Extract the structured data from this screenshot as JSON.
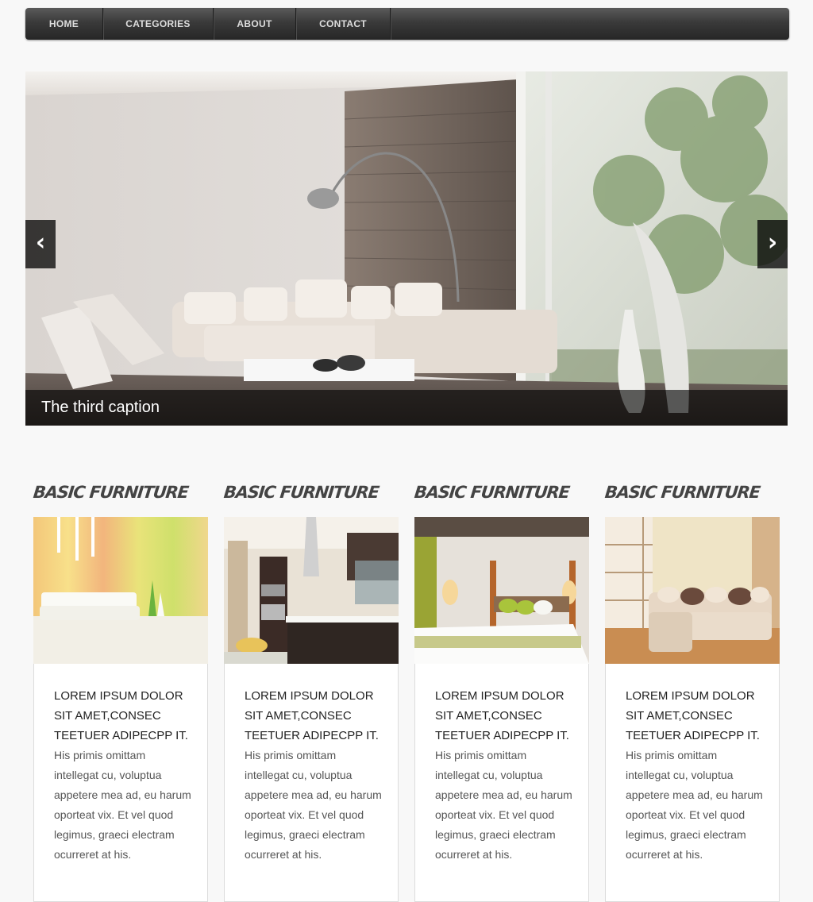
{
  "nav": {
    "items": [
      {
        "label": "HOME"
      },
      {
        "label": "CATEGORIES"
      },
      {
        "label": "ABOUT"
      },
      {
        "label": "CONTACT"
      }
    ]
  },
  "slider": {
    "caption": "The third caption",
    "prev_icon": "‹",
    "next_icon": "›"
  },
  "cards": [
    {
      "heading": "BASIC FURNITURE",
      "title": "LOREM IPSUM DOLOR SIT AMET,CONSEC TEETUER ADIPECPP IT.",
      "text": "His primis omittam intellegat cu, voluptua appetere mea ad, eu harum oporteat vix. Et vel quod legimus, graeci electram ocurreret at his."
    },
    {
      "heading": "BASIC FURNITURE",
      "title": "LOREM IPSUM DOLOR SIT AMET,CONSEC TEETUER ADIPECPP IT.",
      "text": "His primis omittam intellegat cu, voluptua appetere mea ad, eu harum oporteat vix. Et vel quod legimus, graeci electram ocurreret at his."
    },
    {
      "heading": "BASIC FURNITURE",
      "title": "LOREM IPSUM DOLOR SIT AMET,CONSEC TEETUER ADIPECPP IT.",
      "text": "His primis omittam intellegat cu, voluptua appetere mea ad, eu harum oporteat vix. Et vel quod legimus, graeci electram ocurreret at his."
    },
    {
      "heading": "BASIC FURNITURE",
      "title": "LOREM IPSUM DOLOR SIT AMET,CONSEC TEETUER ADIPECPP IT.",
      "text": "His primis omittam intellegat cu, voluptua appetere mea ad, eu harum oporteat vix. Et vel quod legimus, graeci electram ocurreret at his."
    }
  ]
}
